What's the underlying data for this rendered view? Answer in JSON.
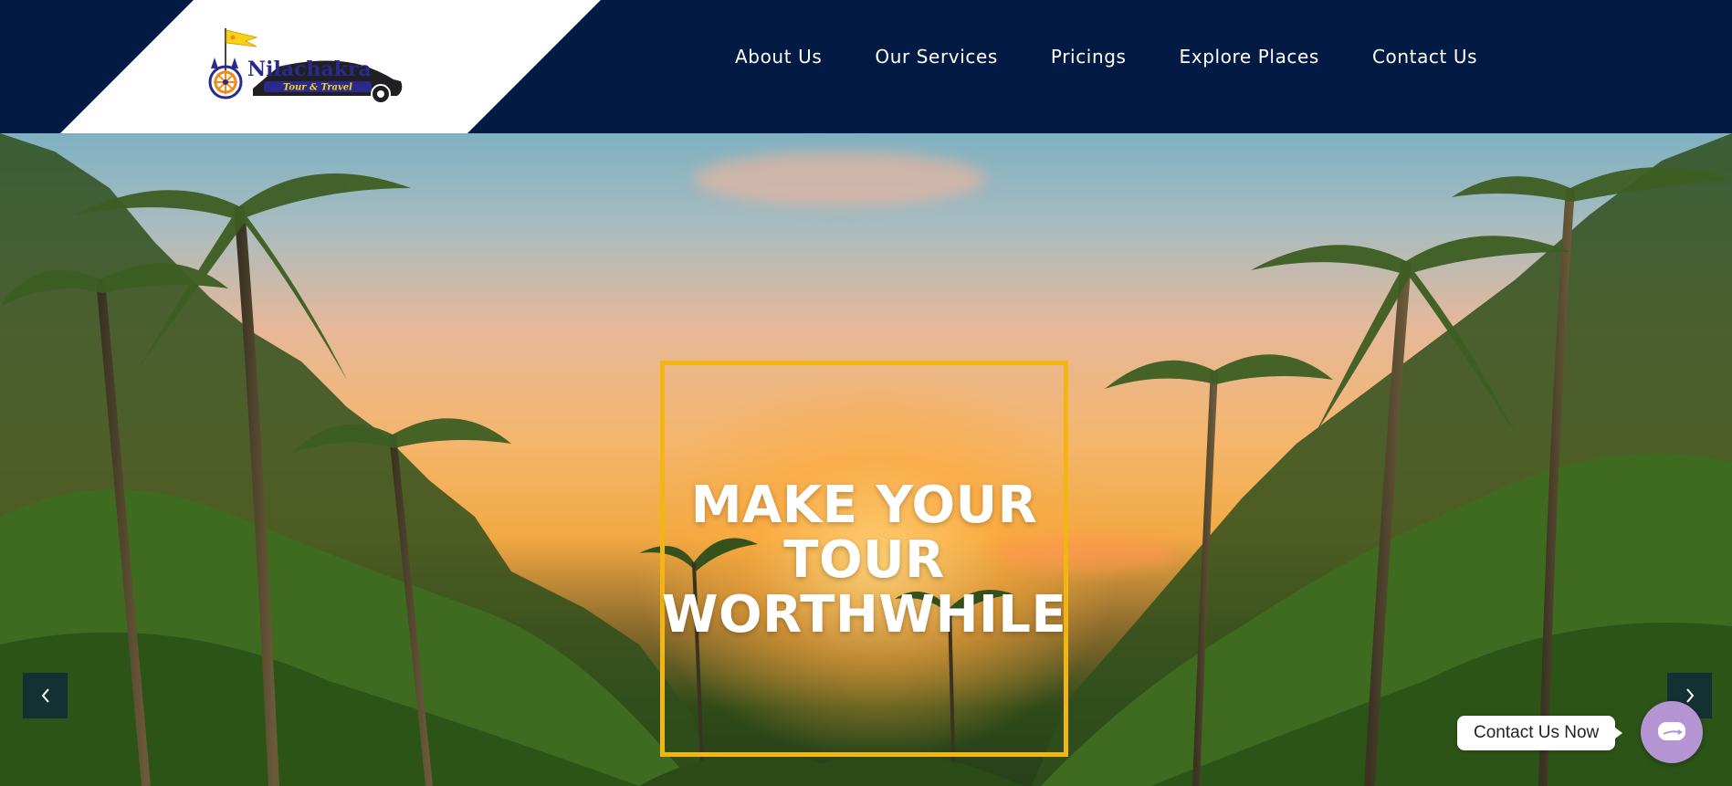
{
  "brand": {
    "name": "Nilachakra",
    "tagline": "Tour & Travel",
    "colors": {
      "navy": "#031a45",
      "accent": "#f2b511",
      "logo_blue": "#2a2a8c",
      "logo_orange": "#f28a1c",
      "logo_yellow": "#f7d21a"
    }
  },
  "nav": {
    "items": [
      {
        "label": "About Us"
      },
      {
        "label": "Our Services"
      },
      {
        "label": "Pricings"
      },
      {
        "label": "Explore Places"
      },
      {
        "label": "Contact Us"
      }
    ]
  },
  "hero": {
    "headline_lines": [
      "MAKE YOUR",
      "TOUR",
      "WORTHWHILE"
    ],
    "prev_icon": "chevron-left-icon",
    "next_icon": "chevron-right-icon"
  },
  "contact_widget": {
    "label": "Contact Us Now",
    "icon": "chat-icon",
    "color": "#b594d4"
  }
}
